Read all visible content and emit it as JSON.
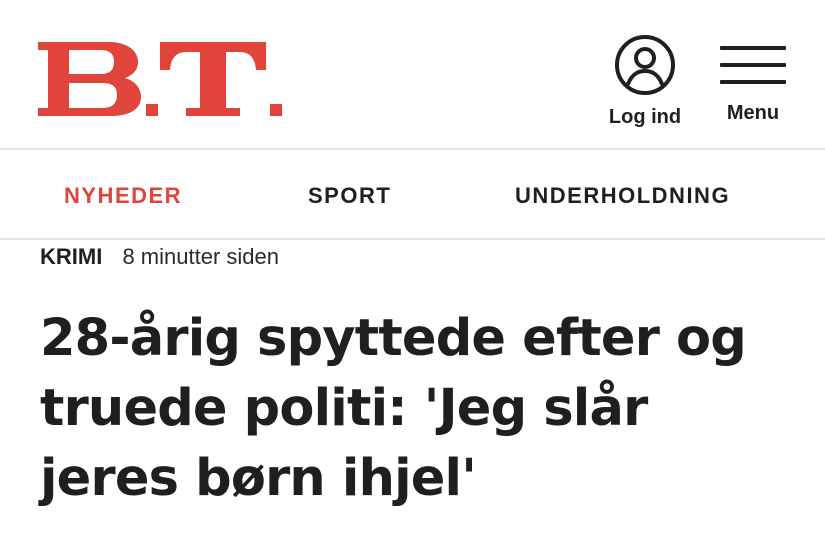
{
  "header": {
    "logo_text": "B.T.",
    "brand_color": "#e0443a",
    "login_label": "Log ind",
    "login_icon": "user-circle-icon",
    "menu_label": "Menu",
    "menu_icon": "hamburger-icon"
  },
  "nav": {
    "items": [
      {
        "label": "NYHEDER",
        "active": true
      },
      {
        "label": "SPORT",
        "active": false
      },
      {
        "label": "UNDERHOLDNING",
        "active": false
      }
    ]
  },
  "article": {
    "section": "KRIMI",
    "time": "8 minutter siden",
    "headline": "28-årig spyttede efter og truede politi: 'Jeg slår jeres børn ihjel'"
  }
}
